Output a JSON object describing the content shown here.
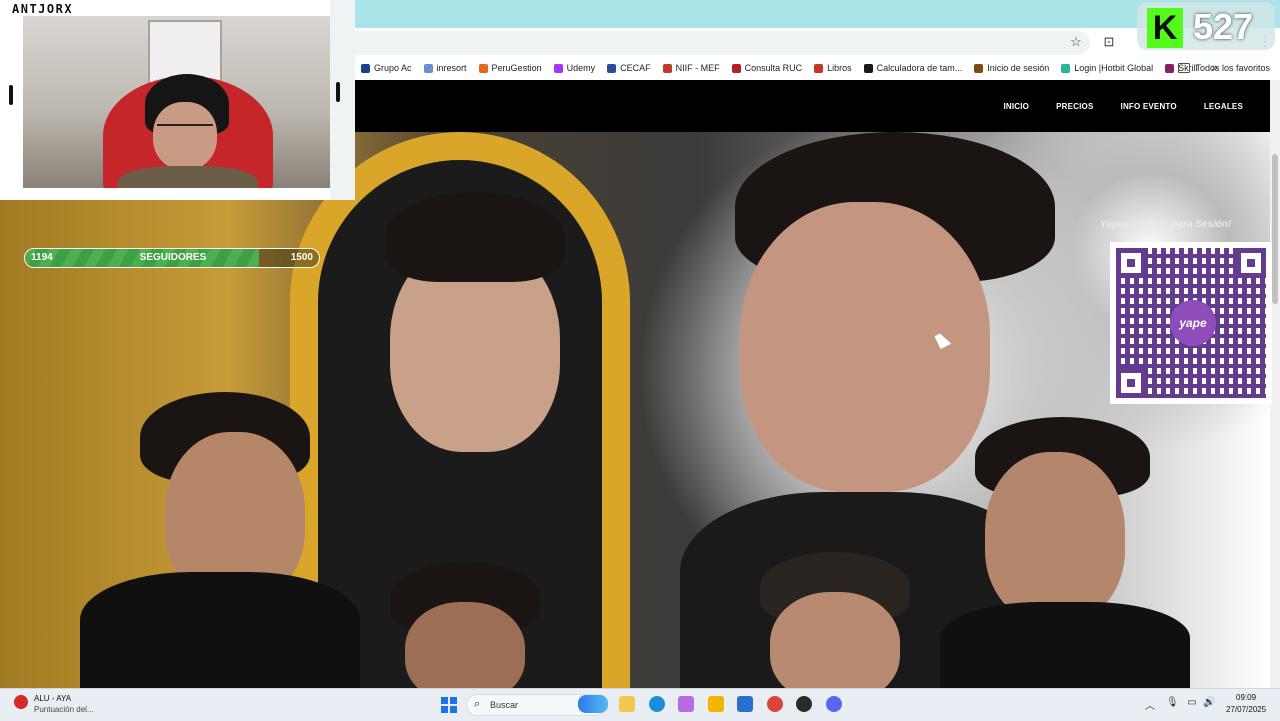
{
  "overlay": {
    "streamer_name": "ANTJORX",
    "followers": {
      "current": "1194",
      "label": "SEGUIDORES",
      "goal": "1500",
      "progress": 0.796
    },
    "kick_viewers": "527"
  },
  "browser": {
    "bookmarks": [
      {
        "label": "Grupo Ac",
        "color": "#1d3f8f"
      },
      {
        "label": "inresort",
        "color": "#6a8fd0"
      },
      {
        "label": "PeruGestion",
        "color": "#e36a1d"
      },
      {
        "label": "Udemy",
        "color": "#a435f0"
      },
      {
        "label": "CECAF",
        "color": "#2a4d9b"
      },
      {
        "label": "NIIF - MEF",
        "color": "#c0392b"
      },
      {
        "label": "Consulta RUC",
        "color": "#b3202a"
      },
      {
        "label": "Libros",
        "color": "#c0392b"
      },
      {
        "label": "Calculadora de tam...",
        "color": "#1a1a1a"
      },
      {
        "label": "Inicio de sesión",
        "color": "#7a4d12"
      },
      {
        "label": "Login |Hotbit Global",
        "color": "#2bb39b"
      },
      {
        "label": "Skrill",
        "color": "#862165"
      }
    ],
    "all_bookmarks_label": "Todos los favoritos",
    "more_label": "»"
  },
  "site": {
    "nav": [
      "INICIO",
      "PRECIOS",
      "INFO EVENTO",
      "LEGALES"
    ],
    "qr_caption": "Yapea en Perú para Sesión!",
    "qr_logo": "yape"
  },
  "taskbar": {
    "weather_title": "ALU - AYA",
    "weather_sub": "Puntuación del...",
    "search_placeholder": "Buscar",
    "time": "09:09",
    "date": "27/07/2025",
    "apps": [
      {
        "name": "file-explorer",
        "color": "#f2c94c"
      },
      {
        "name": "edge",
        "color": "#1b8fd6"
      },
      {
        "name": "copilot",
        "color": "#b66be0"
      },
      {
        "name": "folder",
        "color": "#f5b400"
      },
      {
        "name": "store",
        "color": "#2a6fd1"
      },
      {
        "name": "chrome",
        "color": "#db4437"
      },
      {
        "name": "obs",
        "color": "#2b2b2b"
      },
      {
        "name": "discord",
        "color": "#5865f2"
      }
    ]
  }
}
